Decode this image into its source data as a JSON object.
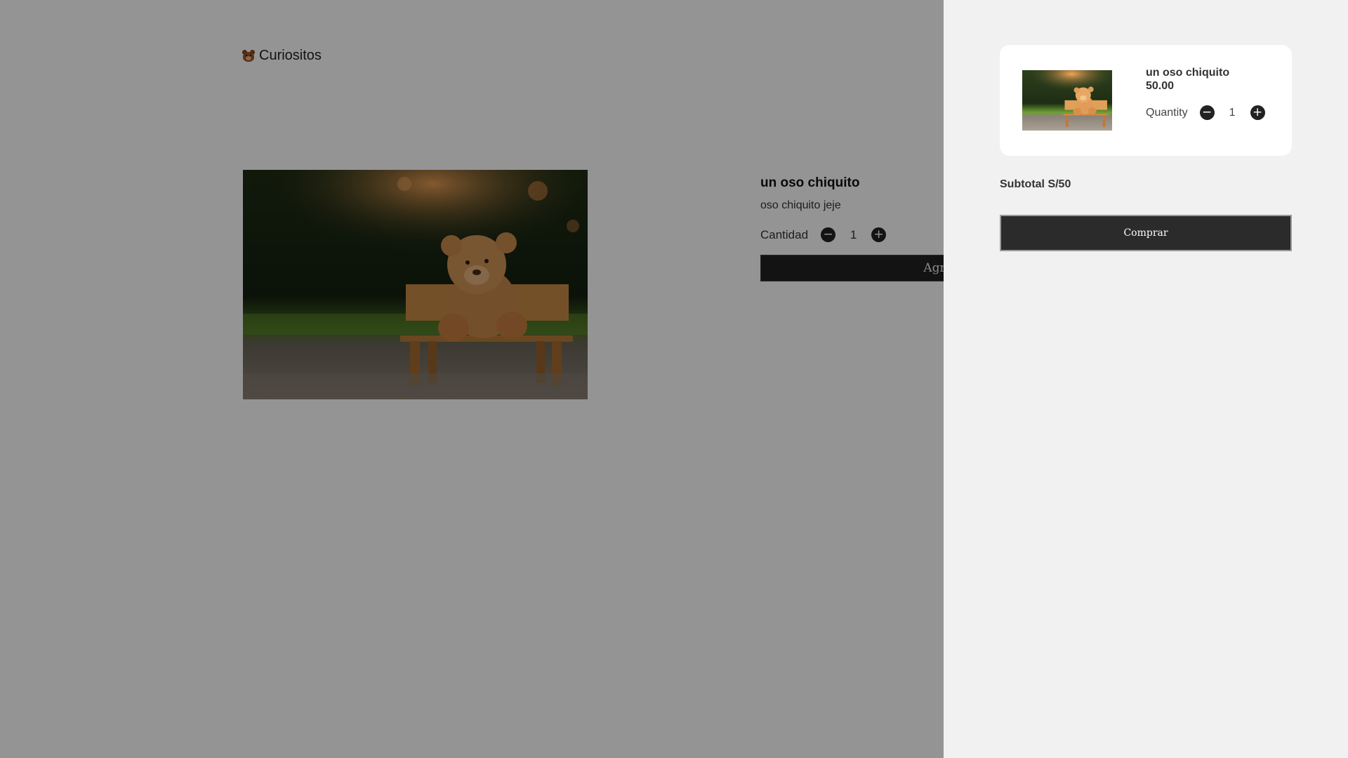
{
  "brand": {
    "name": "Curiositos",
    "icon": "bear-icon"
  },
  "product": {
    "image_alt": "teddy-bear-on-bench",
    "title": "un oso chiquito",
    "description": "oso chiquito jeje",
    "quantity_label": "Cantidad",
    "quantity": "1",
    "decrement_icon": "minus-icon",
    "increment_icon": "plus-icon",
    "add_button_label": "Agregar al carrito"
  },
  "cart": {
    "items": [
      {
        "name": "un oso chiquito",
        "price": "50.00",
        "quantity_label": "Quantity",
        "quantity": "1"
      }
    ],
    "subtotal": "Subtotal S/50",
    "buy_label": "Comprar"
  },
  "colors": {
    "overlay": "#000000",
    "drawer_bg": "#f1f1f1",
    "button_bg": "#2b2b2b",
    "card_bg": "#ffffff"
  }
}
